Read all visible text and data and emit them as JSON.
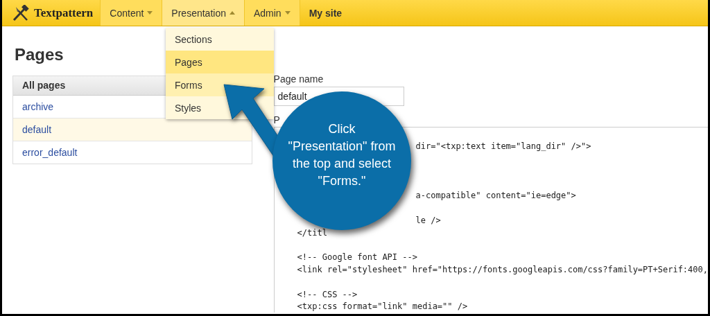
{
  "brand": {
    "name": "Textpattern"
  },
  "nav": [
    {
      "label": "Content",
      "has_menu": true,
      "selected": false
    },
    {
      "label": "Presentation",
      "has_menu": true,
      "selected": true
    },
    {
      "label": "Admin",
      "has_menu": true,
      "selected": false
    },
    {
      "label": "My site",
      "has_menu": false,
      "selected": false
    }
  ],
  "dropdown": [
    {
      "label": "Sections",
      "selected": false,
      "hovered": false
    },
    {
      "label": "Pages",
      "selected": true,
      "hovered": false
    },
    {
      "label": "Forms",
      "selected": false,
      "hovered": true
    },
    {
      "label": "Styles",
      "selected": false,
      "hovered": false
    }
  ],
  "page_title": "Pages",
  "pages_list": {
    "heading": "All pages",
    "items": [
      {
        "label": "archive",
        "selected": false
      },
      {
        "label": "default",
        "selected": true
      },
      {
        "label": "error_default",
        "selected": false
      }
    ]
  },
  "page_name": {
    "label": "Page name",
    "value": "default"
  },
  "code_label": "P",
  "code": [
    {
      "text": "dir=\"<txp:text item=\"lang_dir\" />\">",
      "kind": "clipped"
    },
    {
      "kind": "blank"
    },
    {
      "kind": "blank"
    },
    {
      "kind": "blank"
    },
    {
      "text": "a-compatible\" content=\"ie=edge\">",
      "kind": "clipped"
    },
    {
      "kind": "blank"
    },
    {
      "text": "le />",
      "kind": "clipped"
    },
    {
      "text": "</titl",
      "kind": "indented"
    },
    {
      "kind": "blank"
    },
    {
      "text": "<!-- Google font API -->",
      "kind": "indented"
    },
    {
      "text": "<link rel=\"stylesheet\" href=\"https://fonts.googleapis.com/css?family=PT+Serif:400,",
      "kind": "indented"
    },
    {
      "kind": "blank"
    },
    {
      "text": "<!-- CSS -->",
      "kind": "indented"
    },
    {
      "text": "<txp:css format=\"link\" media=\"\" />",
      "kind": "indented"
    }
  ],
  "callout": {
    "lines": [
      "Click",
      "\"Presentation\" from",
      "the top and select",
      "\"Forms.\""
    ]
  }
}
